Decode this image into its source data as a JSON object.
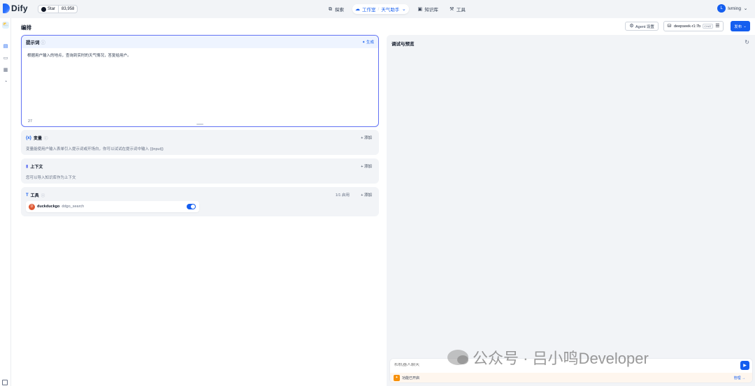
{
  "brand": {
    "name": "Dify",
    "github_label": "Star",
    "github_count": "83,958"
  },
  "nav": {
    "explore": "探索",
    "studio": "工作室",
    "app_name": "天气助手",
    "knowledge": "知识库",
    "tools": "工具"
  },
  "user": {
    "initial": "L",
    "name": "lvming"
  },
  "header": {
    "title": "编排",
    "agent_settings": "Agent 设置",
    "model_name": "deepseek-r1:7b",
    "model_tag": "CHAT",
    "publish": "发布"
  },
  "prompt": {
    "label": "提示词",
    "generate": "生成",
    "text": "根据用户输入的地点，查询到实时的天气情况，答复给用户。",
    "count": "27"
  },
  "variables": {
    "label": "变量",
    "add": "添加",
    "description": "变量能使用户输入表单引入提示词或开场白，你可以试试在提示词中输入 {{input}}"
  },
  "context": {
    "label": "上下文",
    "add": "添加",
    "description": "您可以导入知识库作为上下文"
  },
  "tools": {
    "label": "工具",
    "enabled_count": "1/1 启用",
    "add": "添加",
    "items": [
      {
        "name": "duckduckgo",
        "tool": "ddgo_search",
        "enabled": true
      }
    ]
  },
  "debug": {
    "title": "调试与预览",
    "chat_placeholder": "和机器人聊天",
    "feature_text": "功能已开启",
    "manage": "管理"
  },
  "watermark": {
    "text": "公众号 · 吕小鸣Developer"
  },
  "colors": {
    "accent": "#155eef",
    "prompt_border": "#6172f3"
  }
}
